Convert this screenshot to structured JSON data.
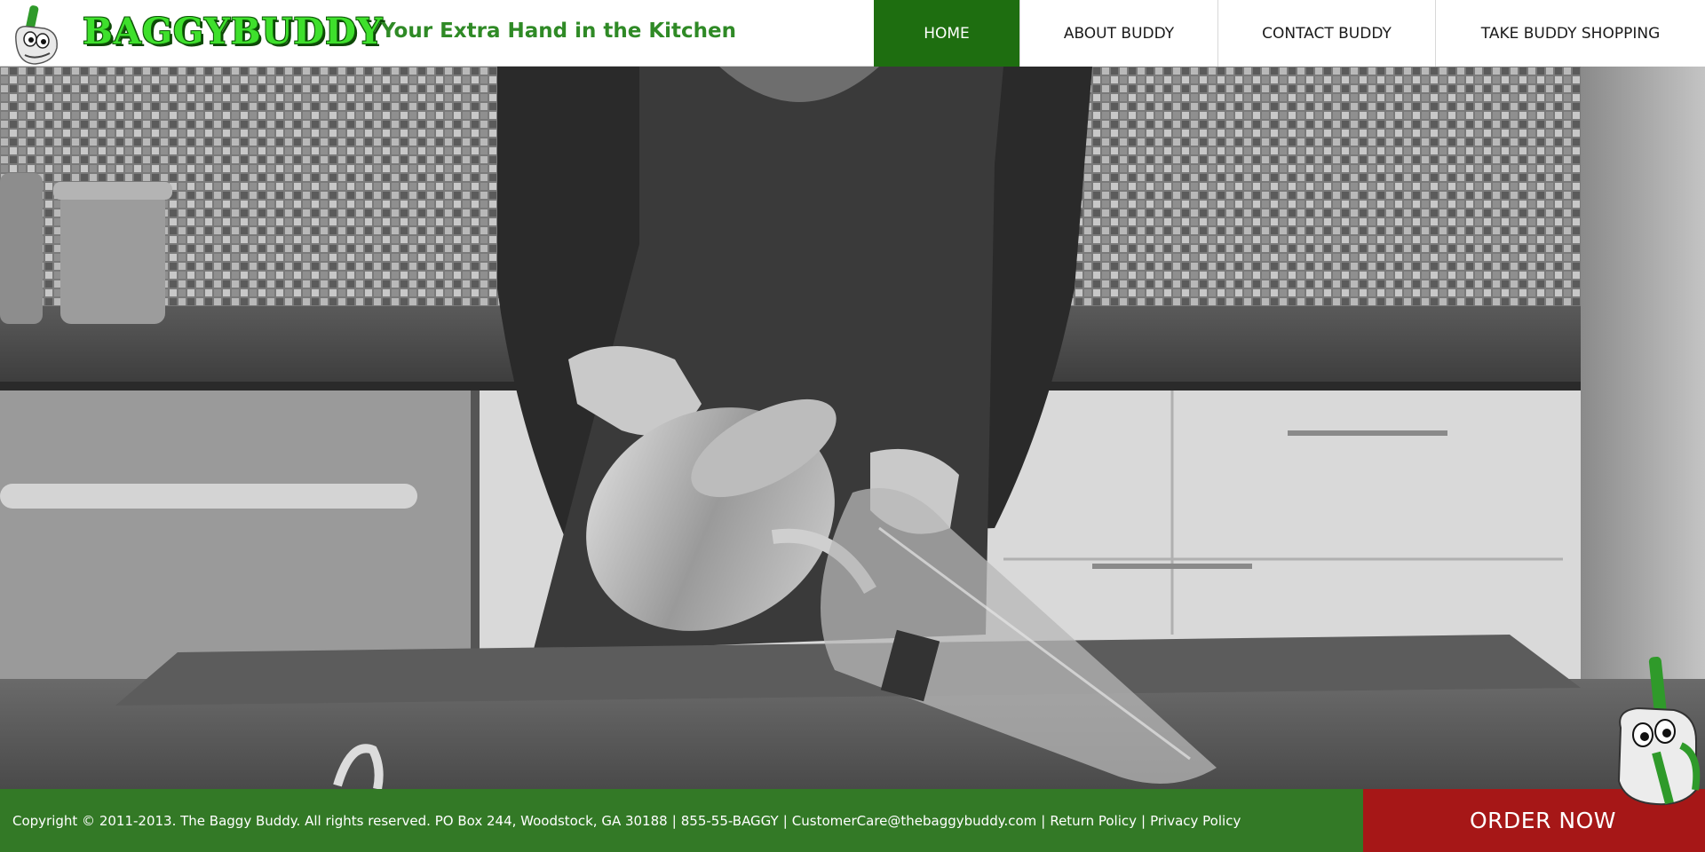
{
  "header": {
    "brand": "BAGGYBUDDY",
    "tagline": "Your Extra Hand in the Kitchen",
    "nav": [
      {
        "label": "HOME",
        "active": true
      },
      {
        "label": "ABOUT BUDDY",
        "active": false
      },
      {
        "label": "CONTACT BUDDY",
        "active": false
      },
      {
        "label": "TAKE BUDDY SHOPPING",
        "active": false
      }
    ]
  },
  "hero": {
    "media": "kitchen-video-still",
    "description_icon": "video-background"
  },
  "footer": {
    "copyright": "Copyright © 2011-2013. The Baggy Buddy. All rights reserved. PO Box 244, Woodstock, GA 30188",
    "phone": "855-55-BAGGY",
    "email": "CustomerCare@thebaggybuddy.com",
    "return_policy": "Return Policy",
    "privacy_policy": "Privacy Policy",
    "separator": "|"
  },
  "cta": {
    "order_label": "ORDER NOW"
  },
  "colors": {
    "brand_green": "#3ee02c",
    "nav_active": "#1e6e10",
    "tagline_green": "#2f8a26",
    "footer_green": "#307c22",
    "order_red": "#a61717"
  }
}
